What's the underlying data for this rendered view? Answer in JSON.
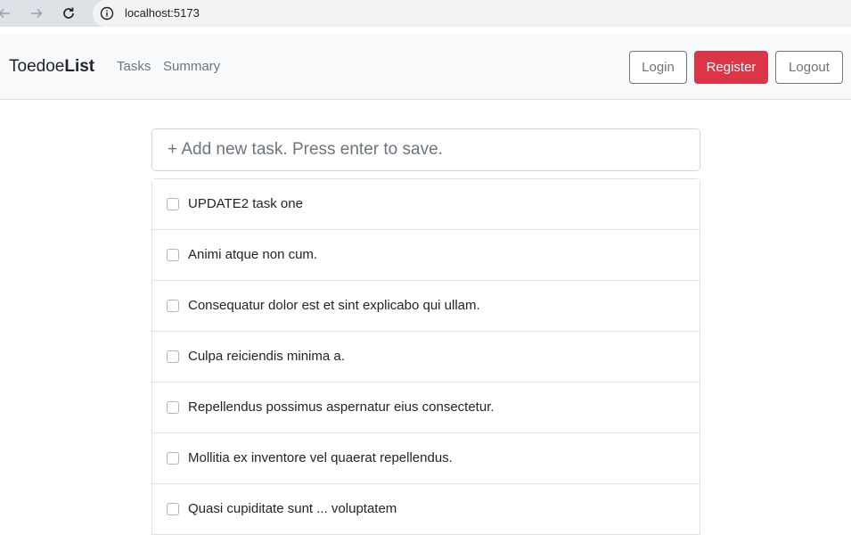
{
  "browser": {
    "url": "localhost:5173",
    "back_icon": "arrow-left-icon",
    "forward_icon": "arrow-right-icon",
    "reload_icon": "reload-icon",
    "info_icon": "info-icon"
  },
  "navbar": {
    "brand_regular": "Toedoe",
    "brand_bold": "List",
    "links": [
      {
        "label": "Tasks"
      },
      {
        "label": "Summary"
      }
    ],
    "buttons": {
      "login": "Login",
      "register": "Register",
      "logout": "Logout"
    }
  },
  "new_task": {
    "placeholder": "+ Add new task. Press enter to save.",
    "value": ""
  },
  "tasks": [
    {
      "text": "UPDATE2 task one",
      "done": false
    },
    {
      "text": "Animi atque non cum.",
      "done": false
    },
    {
      "text": "Consequatur dolor est et sint explicabo qui ullam.",
      "done": false
    },
    {
      "text": "Culpa reiciendis minima a.",
      "done": false
    },
    {
      "text": "Repellendus possimus aspernatur eius consectetur.",
      "done": false
    },
    {
      "text": "Mollitia ex inventore vel quaerat repellendus.",
      "done": false
    },
    {
      "text": "Quasi cupiditate sunt ... voluptatem",
      "done": false
    }
  ],
  "colors": {
    "primary_danger": "#dc3545",
    "outline_secondary": "#6c757d",
    "navbar_bg": "#f8f9fa"
  }
}
